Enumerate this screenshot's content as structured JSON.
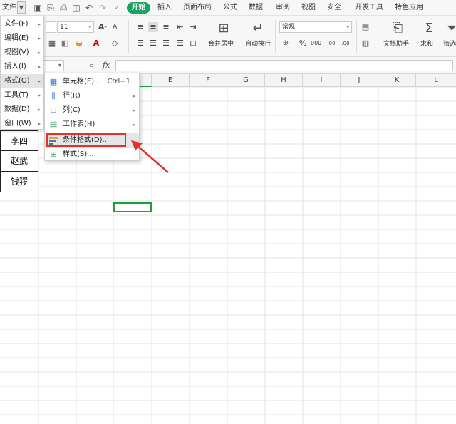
{
  "tabs": {
    "file": "文件",
    "home": "开始",
    "insert": "插入",
    "page_layout": "页面布局",
    "formulas": "公式",
    "data": "数据",
    "review": "审阅",
    "view": "视图",
    "security": "安全",
    "developer": "开发工具",
    "special": "特色应用"
  },
  "ribbon": {
    "font_size": "11",
    "number_format": "常规",
    "merge_center": "合并居中",
    "wrap_text": "自动换行",
    "doc_helper": "文档助手",
    "sum": "求和",
    "filter": "筛选",
    "grow_font": "A",
    "shrink_font": "A",
    "percent": "%",
    "thousands": "000",
    "inc_decimal": ".00",
    "dec_decimal": ".00"
  },
  "formula_bar": {
    "fx_label": "fx"
  },
  "columns": [
    "E",
    "F",
    "G",
    "H",
    "I",
    "J",
    "K",
    "L"
  ],
  "menu_main": {
    "items": [
      {
        "label": "文件(F)"
      },
      {
        "label": "编辑(E)"
      },
      {
        "label": "视图(V)"
      },
      {
        "label": "插入(I)"
      },
      {
        "label": "格式(O)"
      },
      {
        "label": "工具(T)"
      },
      {
        "label": "数据(D)"
      },
      {
        "label": "窗口(W)"
      }
    ],
    "active_index": 4
  },
  "menu_format": {
    "items": [
      {
        "label": "单元格(E)...",
        "shortcut": "Ctrl+1"
      },
      {
        "label": "行(R)"
      },
      {
        "label": "列(C)"
      },
      {
        "label": "工作表(H)"
      },
      {
        "label": "条件格式(D)..."
      },
      {
        "label": "样式(S)..."
      }
    ],
    "highlighted_index": 4
  },
  "cells": {
    "names": [
      "李四",
      "赵武",
      "钱猡"
    ]
  },
  "colors": {
    "accent_green": "#1aa260",
    "annotation_red": "#e0332f",
    "selection_green": "#1e9e3a"
  }
}
